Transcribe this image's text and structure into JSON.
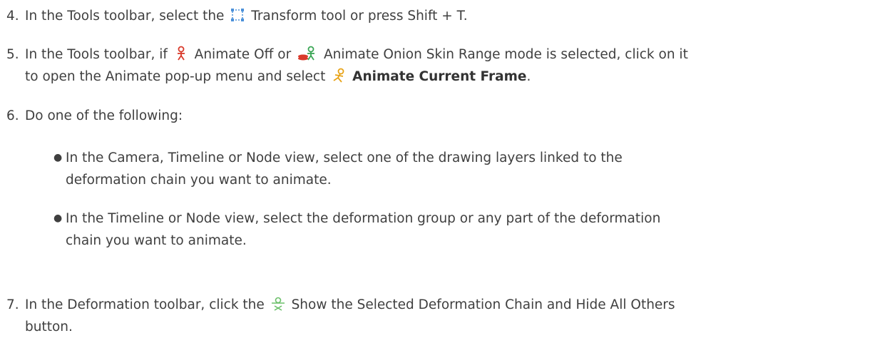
{
  "steps": [
    {
      "number": "4.",
      "before": "In the Tools toolbar, select the",
      "icon": "transform-tool-icon",
      "after": "Transform tool or press Shift + T."
    },
    {
      "number": "5.",
      "part1": "In the Tools toolbar, if",
      "icon1": "animate-off-icon",
      "part2": "Animate Off or",
      "icon2": "animate-onion-skin-range-icon",
      "part3": "Animate Onion Skin Range mode is selected, click on it",
      "line2_part1": "to open the Animate pop-up menu and select",
      "icon3": "animate-current-frame-icon",
      "bold": "Animate Current Frame",
      "end": "."
    },
    {
      "number": "6.",
      "text": "Do one of the following:"
    },
    {
      "number": "7.",
      "part1": "In the Deformation toolbar, click the",
      "icon": "show-selected-deformation-chain-icon",
      "part2": "Show the Selected Deformation Chain and Hide All Others",
      "line2": "button."
    }
  ],
  "bullets": [
    {
      "line1": "In the Camera, Timeline or Node view, select one of the drawing layers linked to the",
      "line2": "deformation chain you want to animate."
    },
    {
      "line1": "In the Timeline or Node view, select the deformation group or any part of the deformation",
      "line2": "chain you want to animate."
    }
  ],
  "colors": {
    "text": "#3f3f3f",
    "transform_icon": "#4a90d9",
    "animate_off_icon": "#d93a2b",
    "onion_skin_icon": "#3aa655",
    "current_frame_icon": "#e8a317",
    "deformation_icon": "#6abf69"
  }
}
